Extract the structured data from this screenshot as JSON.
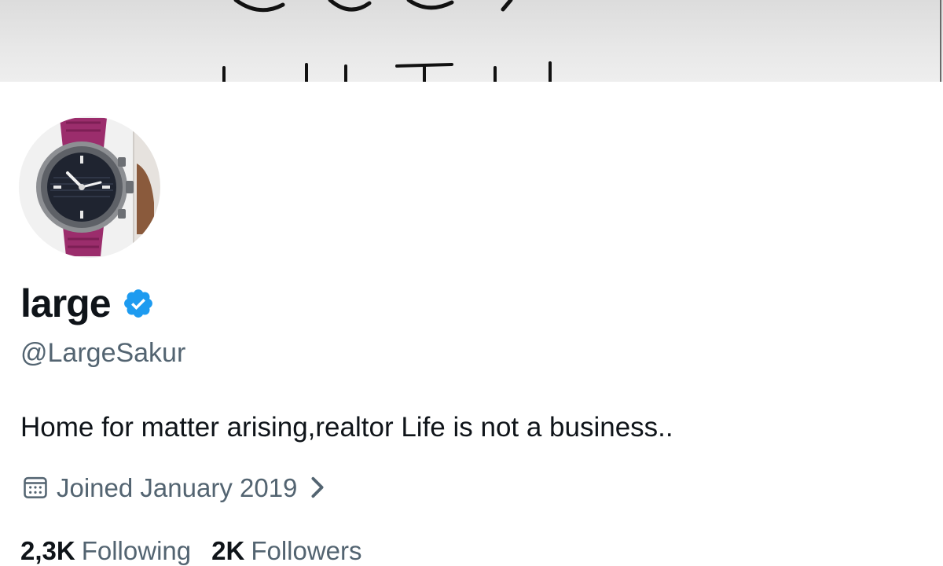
{
  "profile": {
    "display_name": "large",
    "handle": "@LargeSakur",
    "bio": "Home for matter arising,realtor Life is not a business..",
    "joined": "Joined January 2019",
    "following_count": "2,3K",
    "following_label": "Following",
    "followers_count": "2K",
    "followers_label": "Followers"
  },
  "icons": {
    "verified": "verified-badge-icon",
    "calendar": "calendar-icon",
    "chevron": "chevron-right-icon"
  },
  "colors": {
    "verified_blue": "#1d9bf0",
    "primary_text": "#0f1419",
    "secondary_text": "#536471"
  }
}
